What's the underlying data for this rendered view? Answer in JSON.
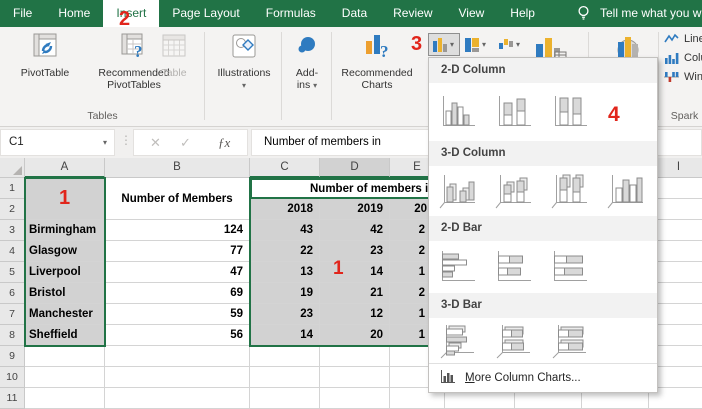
{
  "tabbar": {
    "tabs": [
      "File",
      "Home",
      "Insert",
      "Page Layout",
      "Formulas",
      "Data",
      "Review",
      "View",
      "Help"
    ],
    "selected_tab": "Insert",
    "tell_me": "Tell me what you w"
  },
  "ribbon": {
    "tables_group": {
      "label": "Tables",
      "pivottable": "PivotTable",
      "recommended_pivottables": "Recommended PivotTables",
      "table": "Table"
    },
    "illustrations_group": {
      "label": "Illustrations"
    },
    "addins_group": {
      "line1": "Add-",
      "line2": "ins"
    },
    "charts_group": {
      "recommended_charts": "Recommended Charts"
    },
    "sparklines_group": {
      "label": "Spark",
      "line": "Line",
      "column": "Column",
      "winloss": "Win/Loss"
    }
  },
  "formula_bar": {
    "name_box": "C1",
    "formula": "Number of members in"
  },
  "sheet": {
    "visible_column_headers": [
      "A",
      "B",
      "C",
      "D",
      "E",
      "",
      "",
      "",
      "I"
    ],
    "row_headers": [
      "1",
      "2",
      "3",
      "4",
      "5",
      "6",
      "7",
      "8",
      "9",
      "10",
      "11"
    ],
    "members_header": "Number of Members",
    "year_title": "Number of members in",
    "years": [
      "2018",
      "2019",
      "20"
    ],
    "rows": [
      {
        "city": "Birmingham",
        "members": "124",
        "y2018": "43",
        "y2019": "42",
        "y2020_partial": "2"
      },
      {
        "city": "Glasgow",
        "members": "77",
        "y2018": "22",
        "y2019": "23",
        "y2020_partial": "2"
      },
      {
        "city": "Liverpool",
        "members": "47",
        "y2018": "13",
        "y2019": "14",
        "y2020_partial": "1"
      },
      {
        "city": "Bristol",
        "members": "69",
        "y2018": "19",
        "y2019": "21",
        "y2020_partial": "2"
      },
      {
        "city": "Manchester",
        "members": "59",
        "y2018": "23",
        "y2019": "12",
        "y2020_partial": "1"
      },
      {
        "city": "Sheffield",
        "members": "56",
        "y2018": "14",
        "y2019": "20",
        "y2020_partial": "1"
      }
    ]
  },
  "dropdown": {
    "sections": [
      {
        "title": "2-D Column",
        "thumbs": [
          "clustered-column-icon",
          "stacked-column-icon",
          "100-stacked-column-icon"
        ]
      },
      {
        "title": "3-D Column",
        "thumbs": [
          "3d-clustered-column-icon",
          "3d-stacked-column-icon",
          "3d-100-stacked-column-icon",
          "3d-column-icon"
        ]
      },
      {
        "title": "2-D Bar",
        "thumbs": [
          "clustered-bar-icon",
          "stacked-bar-icon",
          "100-stacked-bar-icon"
        ]
      },
      {
        "title": "3-D Bar",
        "thumbs": [
          "3d-clustered-bar-icon",
          "3d-stacked-bar-icon",
          "3d-100-stacked-bar-icon"
        ]
      }
    ],
    "footer": {
      "underlined": "M",
      "rest": "ore Column Charts..."
    }
  },
  "annotations": {
    "step1": "1",
    "step2": "2",
    "step3": "3",
    "step4": "4",
    "step1_cell": "1"
  },
  "icons": {
    "dropdown_arrow": "▾",
    "cancel": "✕",
    "enter": "✓",
    "fx": "ƒx",
    "dots": "⋮"
  },
  "colors": {
    "excel_green": "#217346",
    "annotation_red": "#e1251b",
    "selection_fill": "#d2d2d2"
  }
}
